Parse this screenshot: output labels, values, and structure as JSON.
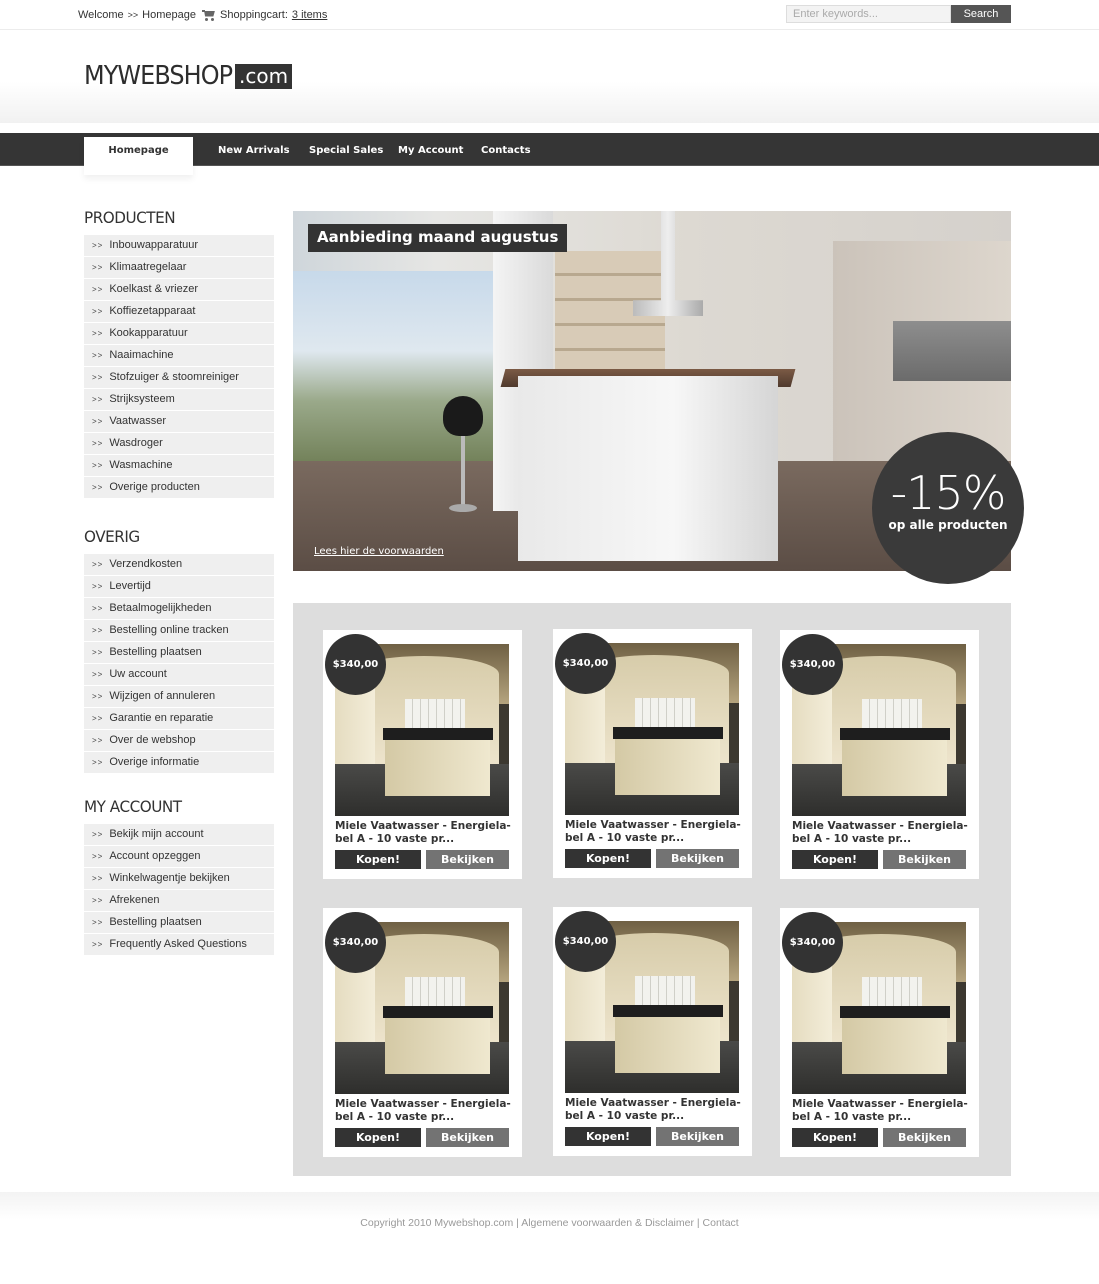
{
  "topbar": {
    "welcome": "Welcome",
    "separator": ">>",
    "breadcrumb_current": "Homepage",
    "cart_label": "Shoppingcart:",
    "cart_count": "3 items",
    "search_placeholder": "Enter keywords...",
    "search_button": "Search"
  },
  "header": {
    "logo_main": "MYWEBSHOP",
    "logo_suffix": ".com"
  },
  "nav": {
    "items": [
      {
        "label": "Homepage",
        "active": true
      },
      {
        "label": "New Arrivals",
        "active": false
      },
      {
        "label": "Special Sales",
        "active": false
      },
      {
        "label": "My Account",
        "active": false
      },
      {
        "label": "Contacts",
        "active": false
      }
    ]
  },
  "sidebar": {
    "arrow": ">>",
    "producten": {
      "heading": "PRODUCTEN",
      "items": [
        "Inbouwapparatuur",
        "Klimaatregelaar",
        "Koelkast & vriezer",
        "Koffiezetapparaat",
        "Kookapparatuur",
        "Naaimachine",
        "Stofzuiger & stoomreiniger",
        "Strijksysteem",
        "Vaatwasser",
        "Wasdroger",
        "Wasmachine",
        "Overige producten"
      ]
    },
    "overig": {
      "heading": "OVERIG",
      "items": [
        "Verzendkosten",
        "Levertijd",
        "Betaalmogelijkheden",
        "Bestelling online tracken",
        "Bestelling plaatsen",
        "Uw account",
        "Wijzigen of annuleren",
        "Garantie en reparatie",
        "Over de webshop",
        "Overige informatie"
      ]
    },
    "account": {
      "heading": "MY ACCOUNT",
      "items": [
        "Bekijk mijn account",
        "Account opzeggen",
        "Winkelwagentje bekijken",
        "Afrekenen",
        "Bestelling plaatsen",
        "Frequently Asked Questions"
      ]
    }
  },
  "banner": {
    "title": "Aanbieding maand augustus",
    "link": "Lees hier de voorwaarden",
    "discount_value": "-15%",
    "discount_text": "op alle producten"
  },
  "products": [
    {
      "price": "$340,00",
      "title": "Miele Vaatwasser - Energiela-bel A - 10 vaste pr...",
      "buy": "Kopen!",
      "view": "Bekijken"
    },
    {
      "price": "$340,00",
      "title": "Miele Vaatwasser - Energiela-bel A - 10 vaste pr...",
      "buy": "Kopen!",
      "view": "Bekijken"
    },
    {
      "price": "$340,00",
      "title": "Miele Vaatwasser - Energiela-bel A - 10 vaste pr...",
      "buy": "Kopen!",
      "view": "Bekijken"
    },
    {
      "price": "$340,00",
      "title": "Miele Vaatwasser - Energiela-bel A - 10 vaste pr...",
      "buy": "Kopen!",
      "view": "Bekijken"
    },
    {
      "price": "$340,00",
      "title": "Miele Vaatwasser - Energiela-bel A - 10 vaste pr...",
      "buy": "Kopen!",
      "view": "Bekijken"
    },
    {
      "price": "$340,00",
      "title": "Miele Vaatwasser - Energiela-bel A - 10 vaste pr...",
      "buy": "Kopen!",
      "view": "Bekijken"
    }
  ],
  "footer": {
    "copyright": "Copyright 2010 Mywebshop.com",
    "sep": "|",
    "terms": "Algemene voorwaarden & Disclaimer",
    "contact": "Contact"
  },
  "colors": {
    "dark": "#333333",
    "nav_bg": "#353535",
    "panel_bg": "#dddddd",
    "sidebar_item_bg": "#efefef",
    "view_button": "#737373"
  }
}
